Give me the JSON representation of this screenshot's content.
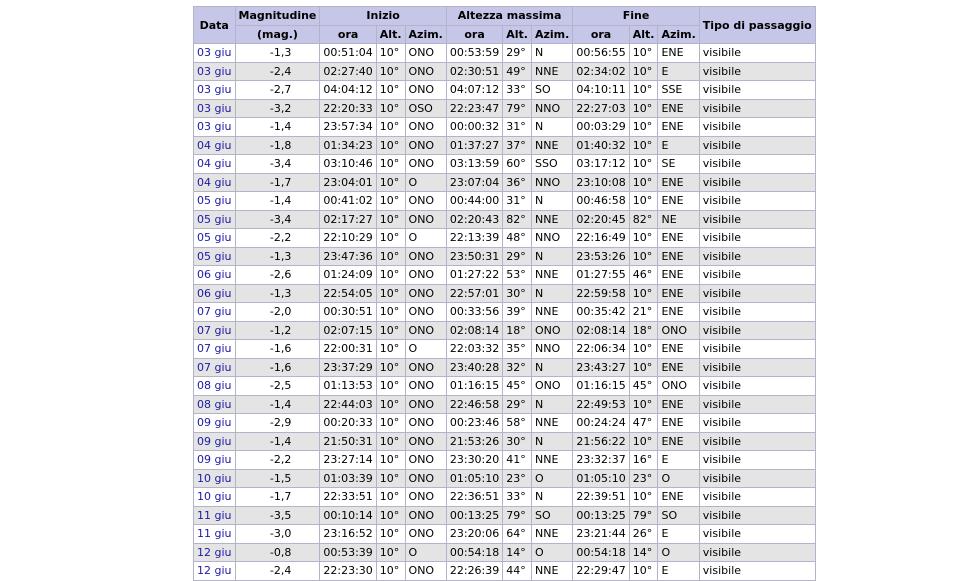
{
  "headers": {
    "data": "Data",
    "magnitudine": "Magnitudine",
    "mag_unit": "(mag.)",
    "inizio": "Inizio",
    "altezza": "Altezza massima",
    "fine": "Fine",
    "tipo": "Tipo di passaggio",
    "ora": "ora",
    "alt": "Alt.",
    "azim": "Azim."
  },
  "rows": [
    [
      "03 giu",
      "-1,3",
      "00:51:04",
      "10°",
      "ONO",
      "00:53:59",
      "29°",
      "N",
      "00:56:55",
      "10°",
      "ENE",
      "visibile"
    ],
    [
      "03 giu",
      "-2,4",
      "02:27:40",
      "10°",
      "ONO",
      "02:30:51",
      "49°",
      "NNE",
      "02:34:02",
      "10°",
      "E",
      "visibile"
    ],
    [
      "03 giu",
      "-2,7",
      "04:04:12",
      "10°",
      "ONO",
      "04:07:12",
      "33°",
      "SO",
      "04:10:11",
      "10°",
      "SSE",
      "visibile"
    ],
    [
      "03 giu",
      "-3,2",
      "22:20:33",
      "10°",
      "OSO",
      "22:23:47",
      "79°",
      "NNO",
      "22:27:03",
      "10°",
      "ENE",
      "visibile"
    ],
    [
      "03 giu",
      "-1,4",
      "23:57:34",
      "10°",
      "ONO",
      "00:00:32",
      "31°",
      "N",
      "00:03:29",
      "10°",
      "ENE",
      "visibile"
    ],
    [
      "04 giu",
      "-1,8",
      "01:34:23",
      "10°",
      "ONO",
      "01:37:27",
      "37°",
      "NNE",
      "01:40:32",
      "10°",
      "E",
      "visibile"
    ],
    [
      "04 giu",
      "-3,4",
      "03:10:46",
      "10°",
      "ONO",
      "03:13:59",
      "60°",
      "SSO",
      "03:17:12",
      "10°",
      "SE",
      "visibile"
    ],
    [
      "04 giu",
      "-1,7",
      "23:04:01",
      "10°",
      "O",
      "23:07:04",
      "36°",
      "NNO",
      "23:10:08",
      "10°",
      "ENE",
      "visibile"
    ],
    [
      "05 giu",
      "-1,4",
      "00:41:02",
      "10°",
      "ONO",
      "00:44:00",
      "31°",
      "N",
      "00:46:58",
      "10°",
      "ENE",
      "visibile"
    ],
    [
      "05 giu",
      "-3,4",
      "02:17:27",
      "10°",
      "ONO",
      "02:20:43",
      "82°",
      "NNE",
      "02:20:45",
      "82°",
      "NE",
      "visibile"
    ],
    [
      "05 giu",
      "-2,2",
      "22:10:29",
      "10°",
      "O",
      "22:13:39",
      "48°",
      "NNO",
      "22:16:49",
      "10°",
      "ENE",
      "visibile"
    ],
    [
      "05 giu",
      "-1,3",
      "23:47:36",
      "10°",
      "ONO",
      "23:50:31",
      "29°",
      "N",
      "23:53:26",
      "10°",
      "ENE",
      "visibile"
    ],
    [
      "06 giu",
      "-2,6",
      "01:24:09",
      "10°",
      "ONO",
      "01:27:22",
      "53°",
      "NNE",
      "01:27:55",
      "46°",
      "ENE",
      "visibile"
    ],
    [
      "06 giu",
      "-1,3",
      "22:54:05",
      "10°",
      "ONO",
      "22:57:01",
      "30°",
      "N",
      "22:59:58",
      "10°",
      "ENE",
      "visibile"
    ],
    [
      "07 giu",
      "-2,0",
      "00:30:51",
      "10°",
      "ONO",
      "00:33:56",
      "39°",
      "NNE",
      "00:35:42",
      "21°",
      "ENE",
      "visibile"
    ],
    [
      "07 giu",
      "-1,2",
      "02:07:15",
      "10°",
      "ONO",
      "02:08:14",
      "18°",
      "ONO",
      "02:08:14",
      "18°",
      "ONO",
      "visibile"
    ],
    [
      "07 giu",
      "-1,6",
      "22:00:31",
      "10°",
      "O",
      "22:03:32",
      "35°",
      "NNO",
      "22:06:34",
      "10°",
      "ENE",
      "visibile"
    ],
    [
      "07 giu",
      "-1,6",
      "23:37:29",
      "10°",
      "ONO",
      "23:40:28",
      "32°",
      "N",
      "23:43:27",
      "10°",
      "ENE",
      "visibile"
    ],
    [
      "08 giu",
      "-2,5",
      "01:13:53",
      "10°",
      "ONO",
      "01:16:15",
      "45°",
      "ONO",
      "01:16:15",
      "45°",
      "ONO",
      "visibile"
    ],
    [
      "08 giu",
      "-1,4",
      "22:44:03",
      "10°",
      "ONO",
      "22:46:58",
      "29°",
      "N",
      "22:49:53",
      "10°",
      "ENE",
      "visibile"
    ],
    [
      "09 giu",
      "-2,9",
      "00:20:33",
      "10°",
      "ONO",
      "00:23:46",
      "58°",
      "NNE",
      "00:24:24",
      "47°",
      "ENE",
      "visibile"
    ],
    [
      "09 giu",
      "-1,4",
      "21:50:31",
      "10°",
      "ONO",
      "21:53:26",
      "30°",
      "N",
      "21:56:22",
      "10°",
      "ENE",
      "visibile"
    ],
    [
      "09 giu",
      "-2,2",
      "23:27:14",
      "10°",
      "ONO",
      "23:30:20",
      "41°",
      "NNE",
      "23:32:37",
      "16°",
      "E",
      "visibile"
    ],
    [
      "10 giu",
      "-1,5",
      "01:03:39",
      "10°",
      "ONO",
      "01:05:10",
      "23°",
      "O",
      "01:05:10",
      "23°",
      "O",
      "visibile"
    ],
    [
      "10 giu",
      "-1,7",
      "22:33:51",
      "10°",
      "ONO",
      "22:36:51",
      "33°",
      "N",
      "22:39:51",
      "10°",
      "ENE",
      "visibile"
    ],
    [
      "11 giu",
      "-3,5",
      "00:10:14",
      "10°",
      "ONO",
      "00:13:25",
      "79°",
      "SO",
      "00:13:25",
      "79°",
      "SO",
      "visibile"
    ],
    [
      "11 giu",
      "-3,0",
      "23:16:52",
      "10°",
      "ONO",
      "23:20:06",
      "64°",
      "NNE",
      "23:21:44",
      "26°",
      "E",
      "visibile"
    ],
    [
      "12 giu",
      "-0,8",
      "00:53:39",
      "10°",
      "O",
      "00:54:18",
      "14°",
      "O",
      "00:54:18",
      "14°",
      "O",
      "visibile"
    ],
    [
      "12 giu",
      "-2,4",
      "22:23:30",
      "10°",
      "ONO",
      "22:26:39",
      "44°",
      "NNE",
      "22:29:47",
      "10°",
      "E",
      "visibile"
    ]
  ]
}
